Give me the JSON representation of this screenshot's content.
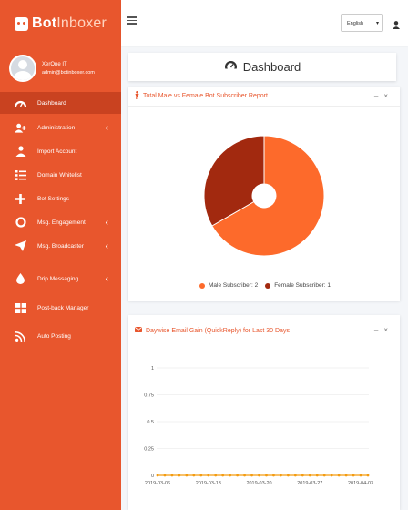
{
  "brand": {
    "name_a": "Bot",
    "name_b": "Inboxer"
  },
  "user": {
    "name": "XerOne IT",
    "email": "admin@botinboxer.com"
  },
  "menu": [
    {
      "label": "Dashboard",
      "icon": "dashboard-icon",
      "active": true,
      "chevron": false
    },
    {
      "label": "Administration",
      "icon": "user-plus-icon",
      "chevron": true
    },
    {
      "label": "Import Account",
      "icon": "import-icon",
      "chevron": false
    },
    {
      "label": "Domain Whitelist",
      "icon": "list-icon",
      "chevron": false
    },
    {
      "label": "Bot Settings",
      "icon": "plus-icon",
      "chevron": false
    },
    {
      "label": "Msg. Engagement",
      "icon": "life-ring-icon",
      "chevron": true
    },
    {
      "label": "Msg. Broadcaster",
      "icon": "paper-plane-icon",
      "chevron": true
    },
    {
      "label": "Drip Messaging",
      "icon": "droplet-icon",
      "chevron": true
    },
    {
      "label": "Post-back Manager",
      "icon": "grid-icon",
      "chevron": false
    },
    {
      "label": "Auto Posting",
      "icon": "rss-icon",
      "chevron": false
    }
  ],
  "topbar": {
    "language": "English"
  },
  "page_title": "Dashboard",
  "pie_card": {
    "title": "Total Male vs Female Bot Subscriber Report",
    "legend": [
      {
        "label": "Male Subscriber: 2",
        "color": "#fd6a2b"
      },
      {
        "label": "Female Subscriber: 1",
        "color": "#a2290f"
      }
    ]
  },
  "line_card": {
    "title": "Daywise Email Gain (QuickReply) for Last 30 Days"
  },
  "chart_data": [
    {
      "type": "pie",
      "categories": [
        "Male Subscriber",
        "Female Subscriber"
      ],
      "values": [
        2,
        1
      ],
      "colors": [
        "#fd6a2b",
        "#a2290f"
      ],
      "title": "Total Male vs Female Bot Subscriber Report",
      "legend_position": "bottom"
    },
    {
      "type": "line",
      "title": "Daywise Email Gain (QuickReply) for Last 30 Days",
      "x": [
        "2019-03-06",
        "2019-03-07",
        "2019-03-08",
        "2019-03-09",
        "2019-03-10",
        "2019-03-11",
        "2019-03-12",
        "2019-03-13",
        "2019-03-14",
        "2019-03-15",
        "2019-03-16",
        "2019-03-17",
        "2019-03-18",
        "2019-03-19",
        "2019-03-20",
        "2019-03-21",
        "2019-03-22",
        "2019-03-23",
        "2019-03-24",
        "2019-03-25",
        "2019-03-26",
        "2019-03-27",
        "2019-03-28",
        "2019-03-29",
        "2019-03-30",
        "2019-03-31",
        "2019-04-01",
        "2019-04-02",
        "2019-04-03",
        "2019-04-04"
      ],
      "y": [
        0,
        0,
        0,
        0,
        0,
        0,
        0,
        0,
        0,
        0,
        0,
        0,
        0,
        0,
        0,
        0,
        0,
        0,
        0,
        0,
        0,
        0,
        0,
        0,
        0,
        0,
        0,
        0,
        0,
        0
      ],
      "yticks": [
        "1",
        "0.75",
        "0.5",
        "0.25",
        "0"
      ],
      "xticks": [
        "2019-03-06",
        "2019-03-13",
        "2019-03-20",
        "2019-03-27",
        "2019-04-03"
      ],
      "ylim": [
        0,
        1
      ],
      "grid": true,
      "color": "#f39c12"
    }
  ]
}
